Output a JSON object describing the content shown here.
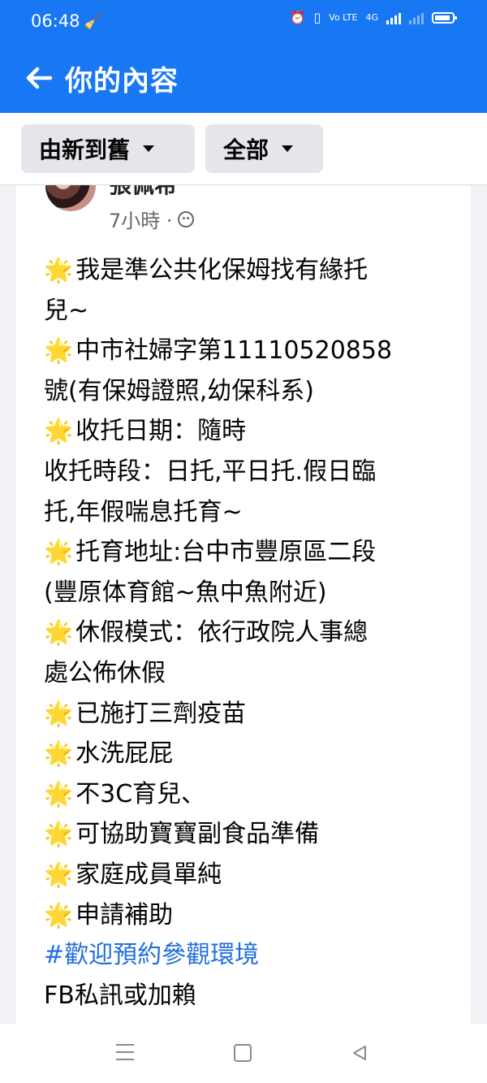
{
  "status_bar": {
    "time": "06:48",
    "broom_icon": "broom-icon",
    "network_text": "4G",
    "lte_text": "Vo LTE"
  },
  "app_bar": {
    "title": "你的內容",
    "back_icon": "arrow-left-icon",
    "background": "#1877f2"
  },
  "filters": {
    "sort_label": "由新到舊",
    "scope_label": "全部"
  },
  "post": {
    "author": "張佩希",
    "time_ago": "7小時 ·",
    "privacy_icon": "friends-icon",
    "star_glyph": "🌟",
    "lines": [
      {
        "star": true,
        "text": "我是準公共化保姆找有緣托"
      },
      {
        "star": false,
        "text": "兒~"
      },
      {
        "star": true,
        "text": "中市社婦字第11110520858"
      },
      {
        "star": false,
        "text": "號(有保姆證照,幼保科系)"
      },
      {
        "star": true,
        "text": "收托日期：隨時"
      },
      {
        "star": false,
        "text": "收托時段：日托,平日托.假日臨"
      },
      {
        "star": false,
        "text": "托,年假喘息托育~"
      },
      {
        "star": true,
        "text": "托育地址:台中市豐原區二段"
      },
      {
        "star": false,
        "text": "(豐原体育館~魚中魚附近)"
      },
      {
        "star": true,
        "text": "休假模式：依行政院人事總"
      },
      {
        "star": false,
        "text": "處公佈休假"
      },
      {
        "star": true,
        "text": "已施打三劑疫苗"
      },
      {
        "star": true,
        "text": "水洗屁屁"
      },
      {
        "star": true,
        "text": "不3C育兒、"
      },
      {
        "star": true,
        "text": "可協助寶寶副食品準備"
      },
      {
        "star": true,
        "text": "家庭成員單純"
      },
      {
        "star": true,
        "text": "申請補助"
      }
    ],
    "hashtag": "#歡迎預約參觀環境",
    "last_line": "FB私訊或加賴"
  },
  "nav": {
    "menu_icon": "menu-icon",
    "home_icon": "home-icon",
    "back_icon": "back-triangle-icon"
  }
}
